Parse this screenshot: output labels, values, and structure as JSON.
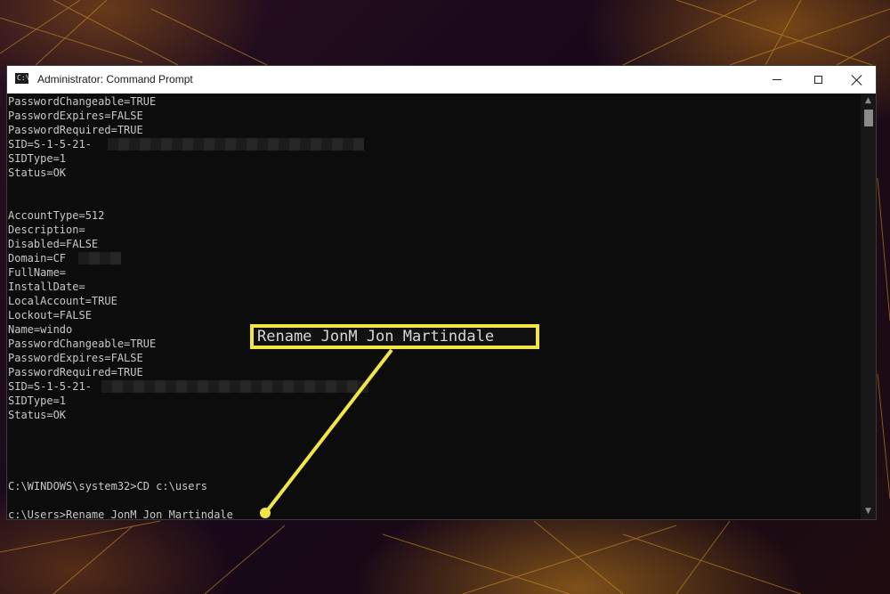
{
  "window": {
    "title": "Administrator: Command Prompt",
    "icon": "cmd-icon",
    "icon_glyph": "C:\\",
    "controls": [
      "minimize-icon",
      "maximize-icon",
      "close-icon"
    ]
  },
  "console": {
    "block1": [
      "PasswordChangeable=TRUE",
      "PasswordExpires=FALSE",
      "PasswordRequired=TRUE",
      "SID=S-1-5-21-",
      "SIDType=1",
      "Status=OK"
    ],
    "block2": [
      "AccountType=512",
      "Description=",
      "Disabled=FALSE",
      "Domain=CF",
      "FullName=",
      "InstallDate=",
      "LocalAccount=TRUE",
      "Lockout=FALSE",
      "Name=windo",
      "PasswordChangeable=TRUE",
      "PasswordExpires=FALSE",
      "PasswordRequired=TRUE",
      "SID=S-1-5-21-",
      "SIDType=1",
      "Status=OK"
    ],
    "cmd1": "C:\\WINDOWS\\system32>CD c:\\users",
    "cmd2": "c:\\Users>Rename JonM Jon Martindale"
  },
  "callout": {
    "text": "Rename JonM Jon Martindale",
    "color": "#f2e545"
  },
  "colors": {
    "console_bg": "#0c0c0c",
    "console_text": "#c8c8c8",
    "titlebar_bg": "#ffffff",
    "accent": "#f2e545"
  }
}
